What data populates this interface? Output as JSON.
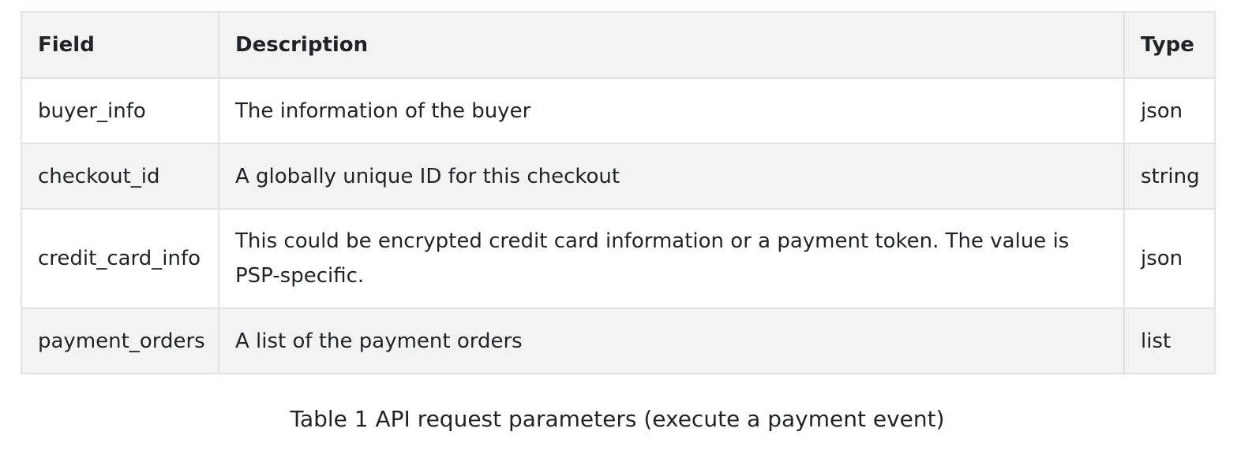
{
  "table": {
    "headers": {
      "field": "Field",
      "description": "Description",
      "type": "Type"
    },
    "rows": [
      {
        "field": "buyer_info",
        "description": "The information of the buyer",
        "type": "json"
      },
      {
        "field": "checkout_id",
        "description": "A globally unique ID for this checkout",
        "type": "string"
      },
      {
        "field": "credit_card_info",
        "description": "This could be encrypted credit card information or a payment token. The value is PSP-specific.",
        "type": "json"
      },
      {
        "field": "payment_orders",
        "description": "A list of the payment orders",
        "type": "list"
      }
    ]
  },
  "caption": "Table 1 API request parameters (execute a payment event)"
}
